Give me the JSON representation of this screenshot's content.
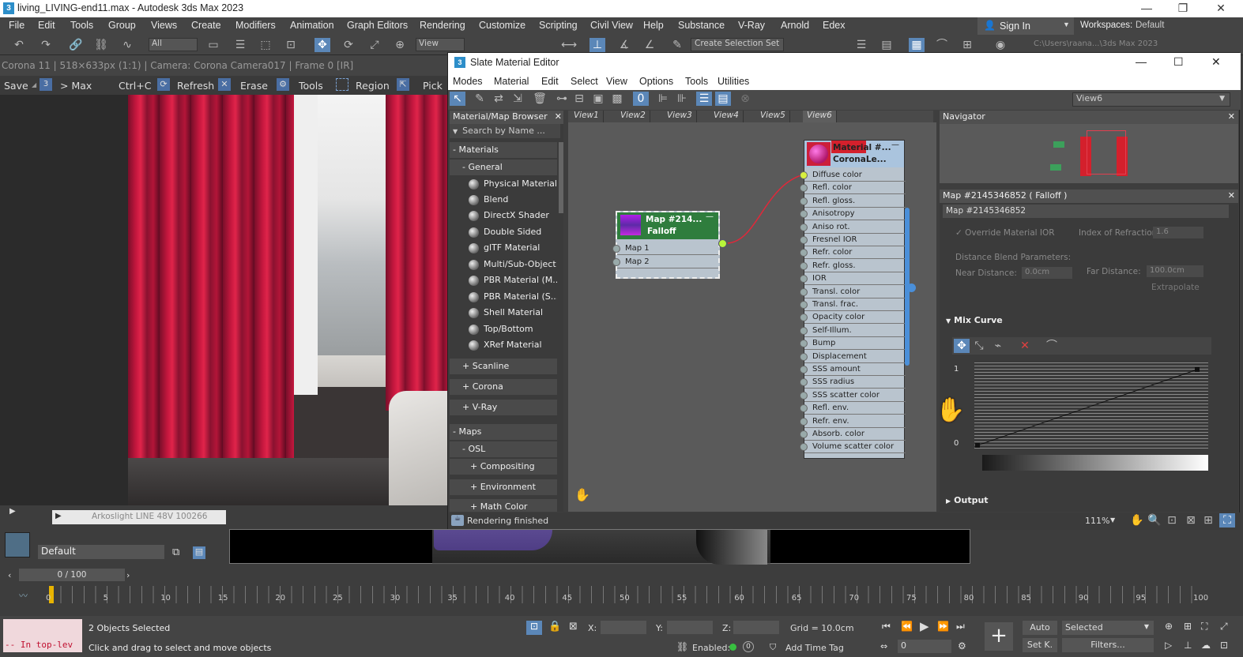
{
  "app": {
    "title": "living_LIVING-end11.max - Autodesk 3ds Max 2023",
    "menus": [
      "File",
      "Edit",
      "Tools",
      "Group",
      "Views",
      "Create",
      "Modifiers",
      "Animation",
      "Graph Editors",
      "Rendering",
      "Customize",
      "Scripting",
      "Civil View",
      "Help",
      "Substance",
      "V-Ray",
      "Arnold",
      "Edex"
    ],
    "sign_in": "Sign In",
    "workspaces_label": "Workspaces:",
    "workspace_value": "Default",
    "filter_all": "All",
    "view_dropdown": "View",
    "create_selection_set": "Create Selection Set",
    "path_text": "C:\\Users\\raana...\\3ds Max 2023"
  },
  "render_window": {
    "info": "Corona 11 | 518×633px (1:1) | Camera: Corona Camera017 | Frame 0 [IR]",
    "buttons": [
      "Save",
      "> Max",
      "Ctrl+C",
      "Refresh",
      "Erase",
      "Tools",
      "Region",
      "Pick"
    ],
    "status": "Rendering finished"
  },
  "sme": {
    "title": "Slate Material Editor",
    "menus": [
      "Modes",
      "Material",
      "Edit",
      "Select",
      "View",
      "Options",
      "Tools",
      "Utilities"
    ],
    "view_select": "View6",
    "browser": {
      "title": "Material/Map Browser",
      "search_placeholder": "Search by Name ...",
      "materials_label": "- Materials",
      "general_label": "- General",
      "general_items": [
        "Physical Material",
        "Blend",
        "DirectX Shader",
        "Double Sided",
        "glTF Material",
        "Multi/Sub-Object",
        "PBR Material (M...",
        "PBR Material (S...",
        "Shell Material",
        "Top/Bottom",
        "XRef Material"
      ],
      "groups": [
        "+ Scanline",
        "+ Corona",
        "+ V-Ray"
      ],
      "maps_label": "- Maps",
      "osl_label": "- OSL",
      "osl_items": [
        "+ Compositing",
        "+ Environment",
        "+ Math Color"
      ]
    },
    "view_tabs": [
      "View1",
      "View2",
      "View3",
      "View4",
      "View5",
      "View6"
    ],
    "map_node": {
      "title1": "Map #214...",
      "title2": "Falloff",
      "slots": [
        "Map 1",
        "Map 2"
      ]
    },
    "material_node": {
      "title1": "Material #...",
      "title2": "CoronaLe...",
      "slots": [
        "Diffuse color",
        "Refl. color",
        "Refl. gloss.",
        "Anisotropy",
        "Aniso rot.",
        "Fresnel IOR",
        "Refr. color",
        "Refr. gloss.",
        "IOR",
        "Transl. color",
        "Transl. frac.",
        "Opacity color",
        "Self-Illum.",
        "Bump",
        "Displacement",
        "SSS amount",
        "SSS radius",
        "SSS scatter color",
        "Refl. env.",
        "Refr. env.",
        "Absorb. color",
        "Volume scatter color"
      ]
    },
    "navigator_title": "Navigator",
    "param_title": "Map #2145346852  ( Falloff )",
    "param_name": "Map #2145346852",
    "override_ior": "Override Material IOR",
    "index_refraction_label": "Index of Refraction",
    "index_refraction_value": "1.6",
    "distance_blend_label": "Distance Blend Parameters:",
    "near_distance_label": "Near Distance:",
    "near_distance_value": "0.0cm",
    "far_distance_label": "Far Distance:",
    "far_distance_value": "100.0cm",
    "extrapolate": "Extrapolate",
    "mix_curve": "Mix Curve",
    "curve_y_top": "1",
    "curve_y_bottom": "0",
    "output": "Output",
    "zoom": "111%"
  },
  "scene": {
    "layer_item": "Arkoslight LINE 48V 100266",
    "layer_default": "Default"
  },
  "timeline": {
    "frame_counter": "0 / 100",
    "ticks": [
      "0",
      "5",
      "10",
      "15",
      "20",
      "25",
      "30",
      "35",
      "40",
      "45",
      "50",
      "55",
      "60",
      "65",
      "70",
      "75",
      "80",
      "85",
      "90",
      "95",
      "100"
    ]
  },
  "status": {
    "objects_selected": "2 Objects Selected",
    "hint": "Click and drag to select and move objects",
    "script_prompt": "-- In top-lev",
    "x_label": "X:",
    "y_label": "Y:",
    "z_label": "Z:",
    "grid": "Grid = 10.0cm",
    "enabled": "Enabled:",
    "add_time_tag": "Add Time Tag",
    "auto": "Auto",
    "set_key": "Set K.",
    "selected": "Selected",
    "filters": "Filters...",
    "frame_value": "0"
  },
  "colors": {
    "accent_blue": "#4a8fd9",
    "node_green": "#2f7d3d",
    "material_head": "#aac4de",
    "wire_red": "#e0283a"
  }
}
